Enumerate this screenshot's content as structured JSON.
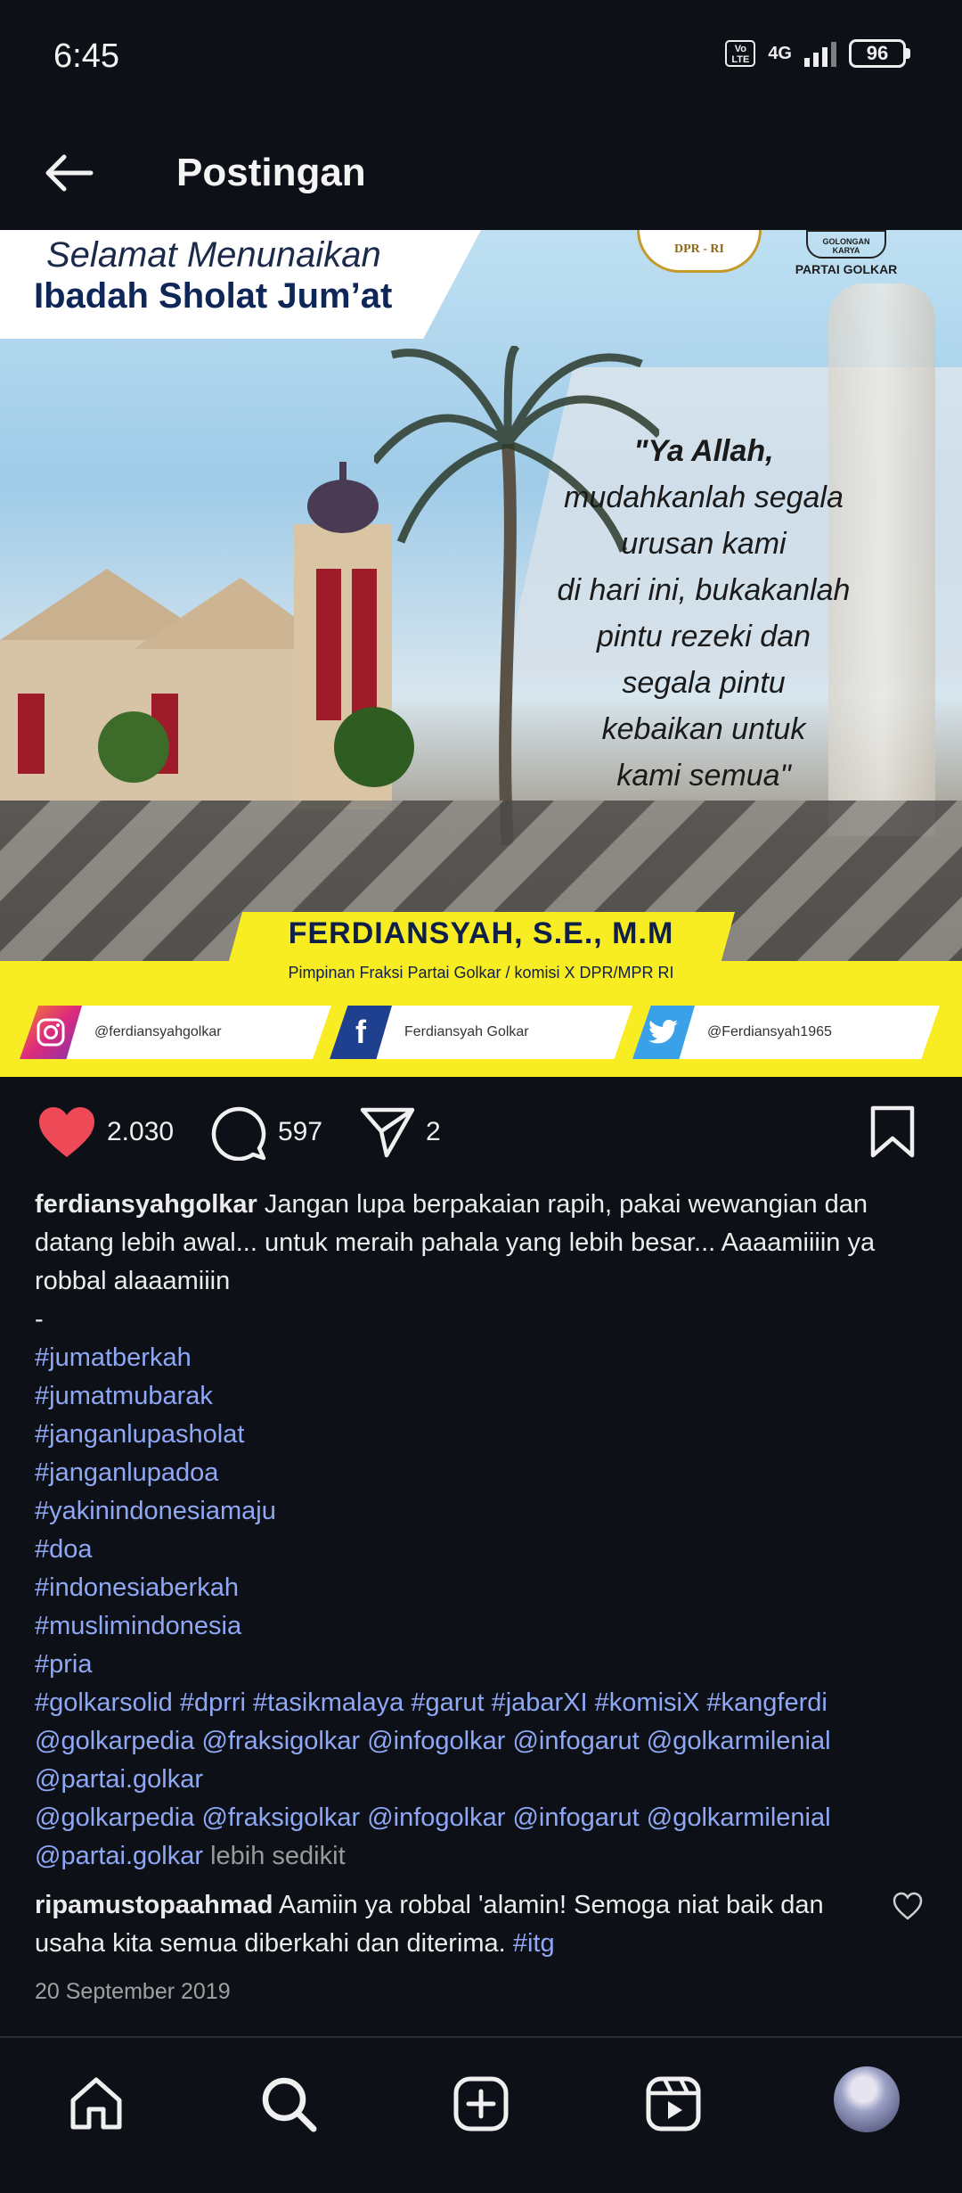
{
  "status_bar": {
    "time": "6:45",
    "volte": "Vo LTE",
    "network": "4G",
    "battery": "96"
  },
  "header": {
    "title": "Postingan"
  },
  "post_image": {
    "greeting_line1": "Selamat Menunaikan",
    "greeting_line2": "Ibadah Sholat Jum’at",
    "logo_dpr": "DPR - RI",
    "logo_golkar_badge": "GOLONGAN KARYA",
    "logo_golkar": "PARTAI GOLKAR",
    "quote": [
      "\"Ya Allah,",
      "mudahkanlah segala",
      "urusan kami",
      "di hari ini, bukakanlah",
      "pintu rezeki dan",
      "segala pintu",
      "kebaikan untuk",
      "kami semua\""
    ],
    "name": "FERDIANSYAH, S.E., M.M",
    "position": "Pimpinan Fraksi Partai Golkar / komisi X DPR/MPR RI",
    "social_instagram": "@ferdiansyahgolkar",
    "social_facebook": "Ferdiansyah Golkar",
    "social_twitter": "@Ferdiansyah1965"
  },
  "actions": {
    "likes": "2.030",
    "comments": "597",
    "shares": "2"
  },
  "caption": {
    "username": "ferdiansyahgolkar",
    "text": "Jangan lupa berpakaian rapih, pakai wewangian dan datang lebih awal... untuk meraih pahala yang lebih besar... Aaaamiiiin ya robbal alaaamiiin",
    "separator": "-",
    "hashtags": [
      "#jumatberkah",
      "#jumatmubarak",
      "#janganlupasholat",
      "#janganlupadoa",
      "#yakinindonesiamaju",
      "#doa",
      "#indonesiaberkah",
      "#muslimindonesia",
      "#pria"
    ],
    "tag_line1": "#golkarsolid  #dprri #tasikmalaya #garut #jabarXI #komisiX #kangferdi",
    "mention_line1": "@golkarpedia @fraksigolkar @infogolkar @infogarut  @golkarmilenial",
    "mention_line2": "@partai.golkar",
    "mention_line3": "@golkarpedia @fraksigolkar @infogolkar @infogarut  @golkarmilenial",
    "mention_line4": "@partai.golkar",
    "less": "lebih sedikit"
  },
  "comment": {
    "username": "ripamustopaahmad",
    "text": "Aamiin ya robbal 'alamin! Semoga niat baik dan usaha kita semua diberkahi dan diterima.",
    "tag": "#itg"
  },
  "date": "20 September 2019",
  "colors": {
    "background": "#0d1117",
    "like_red": "#ed4956",
    "link_blue": "#8fa8f5",
    "banner_yellow": "#f8ec23"
  }
}
